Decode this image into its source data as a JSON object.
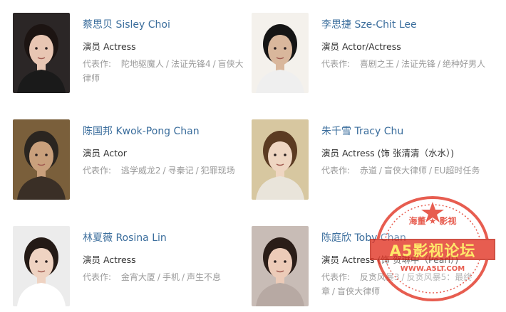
{
  "actors": [
    {
      "name": "蔡思贝 Sisley Choi",
      "role": "演员 Actress",
      "works_label": "代表作:",
      "works": [
        "陀地驱魔人",
        "法证先锋4",
        "盲侠大律师"
      ],
      "photo": {
        "bg": "#2b2626",
        "skin": "#e8c6b3",
        "hair": "#1c1412",
        "cloth": "#1a1a1a"
      }
    },
    {
      "name": "李思捷 Sze-Chit Lee",
      "role": "演员 Actor/Actress",
      "works_label": "代表作:",
      "works": [
        "喜剧之王",
        "法证先锋",
        "绝种好男人"
      ],
      "photo": {
        "bg": "#f4f1ec",
        "skin": "#d9b79c",
        "hair": "#151515",
        "cloth": "#efefef"
      }
    },
    {
      "name": "陈国邦 Kwok-Pong Chan",
      "role": "演员 Actor",
      "works_label": "代表作:",
      "works": [
        "逃学威龙2",
        "寻秦记",
        "犯罪现场"
      ],
      "photo": {
        "bg": "#7a5f3b",
        "skin": "#c9a07c",
        "hair": "#2a2520",
        "cloth": "#3a2f26"
      }
    },
    {
      "name": "朱千雪 Tracy Chu",
      "role": "演员 Actress (饰 张清清（水水）)",
      "works_label": "代表作:",
      "works": [
        "赤道",
        "盲侠大律师",
        "EU超时任务"
      ],
      "photo": {
        "bg": "#d7c7a0",
        "skin": "#efd6c2",
        "hair": "#5b3b22",
        "cloth": "#e9e4da"
      }
    },
    {
      "name": "林夏薇 Rosina Lin",
      "role": "演员 Actress",
      "works_label": "代表作:",
      "works": [
        "金宵大厦",
        "手机",
        "声生不息"
      ],
      "photo": {
        "bg": "#ececec",
        "skin": "#efd3c2",
        "hair": "#241a16",
        "cloth": "#ffffff"
      }
    },
    {
      "name": "陈庭欣 Toby Chan",
      "role": "演员 Actress (饰 贺琳中（Pearl）)",
      "works_label": "代表作:",
      "works": [
        "反贪风暴3",
        "反贪风暴5：最终章",
        "盲侠大律师"
      ],
      "photo": {
        "bg": "#c8bcb6",
        "skin": "#eccbb8",
        "hair": "#2a1d18",
        "cloth": "#b7a9a3"
      }
    }
  ],
  "watermark": {
    "top": "海董 ★ 影视",
    "banner": "A5影视论坛",
    "url": "WWW.A5LT.COM",
    "color": "#e23a2a"
  }
}
